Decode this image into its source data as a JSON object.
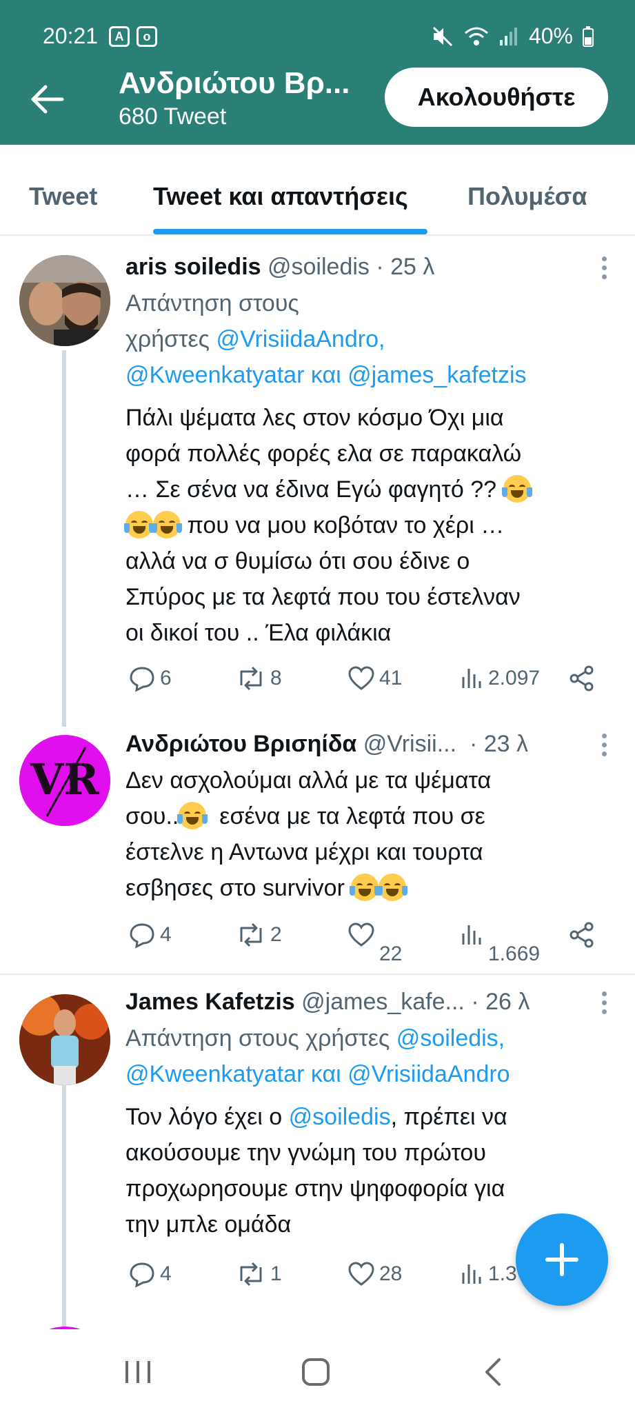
{
  "status_bar": {
    "time": "20:21",
    "battery": "40%"
  },
  "header": {
    "account_name": "Ανδριώτου Βρ...",
    "tweet_count": "680 Tweet",
    "follow_label": "Ακολουθήστε"
  },
  "tabs": [
    {
      "label": "Tweet"
    },
    {
      "label": "Tweet και απαντήσεις"
    },
    {
      "label": "Πολυμέσα"
    }
  ],
  "tweets": [
    {
      "name": "aris soiledis",
      "handle": "@soiledis",
      "time": "25 λ",
      "reply_prefix": "Απάντηση στους",
      "reply_prefix2": "χρήστες",
      "mention1": "@VrisiidaAndro,",
      "mention2": "@Kweenkatyatar",
      "and": "και",
      "mention3": "@james_kafetzis",
      "text_lines": [
        "Πάλι ψέματα λες στον κόσμο Όχι μια",
        "φορά πολλές φορές ελα σε παρακαλώ",
        "… Σε σένα να έδινα Εγώ φαγητό ??",
        "που να μου κοβόταν το χέρι …",
        "αλλά να σ θυμίσω ότι σου έδινε ο",
        "Σπύρος με τα λεφτά που του έστελναν",
        "οι δικοί του .. Έλα φιλάκια"
      ],
      "replies": "6",
      "retweets": "8",
      "likes": "41",
      "views": "2.097"
    },
    {
      "name": "Ανδριώτου Βρισηίδα",
      "handle": "@Vrisii...",
      "time": "23 λ",
      "avatar_text": "VR",
      "text_lines": [
        "Δεν ασχολούμαι αλλά με τα ψέματα",
        "σου..",
        "εσένα με τα λεφτά που σε",
        "έστελνε η Αντωνα μέχρι και τουρτα",
        "εσβησες στο survivor"
      ],
      "replies": "4",
      "retweets": "2",
      "likes": "22",
      "views": "1.669"
    },
    {
      "name": "James Kafetzis",
      "handle": "@james_kafe...",
      "time": "26 λ",
      "reply_prefix": "Απάντηση στους χρήστες",
      "mention1": "@soiledis,",
      "mention2": "@Kweenkatyatar",
      "and": "και",
      "mention3": "@VrisiidaAndro",
      "text_pre": "Τον λόγο έχει ο",
      "text_mention": "@soiledis",
      "text_post": ", πρέπει να",
      "text_lines": [
        "ακούσουμε την γνώμη του πρώτου",
        "προχωρησουμε στην ψηφοφορία για",
        "την μπλε ομάδα"
      ],
      "replies": "4",
      "retweets": "1",
      "likes": "28",
      "views": "1.3"
    }
  ],
  "colors": {
    "header_bg": "#2a8076",
    "accent": "#1d9bf0",
    "muted_text": "#536471"
  }
}
